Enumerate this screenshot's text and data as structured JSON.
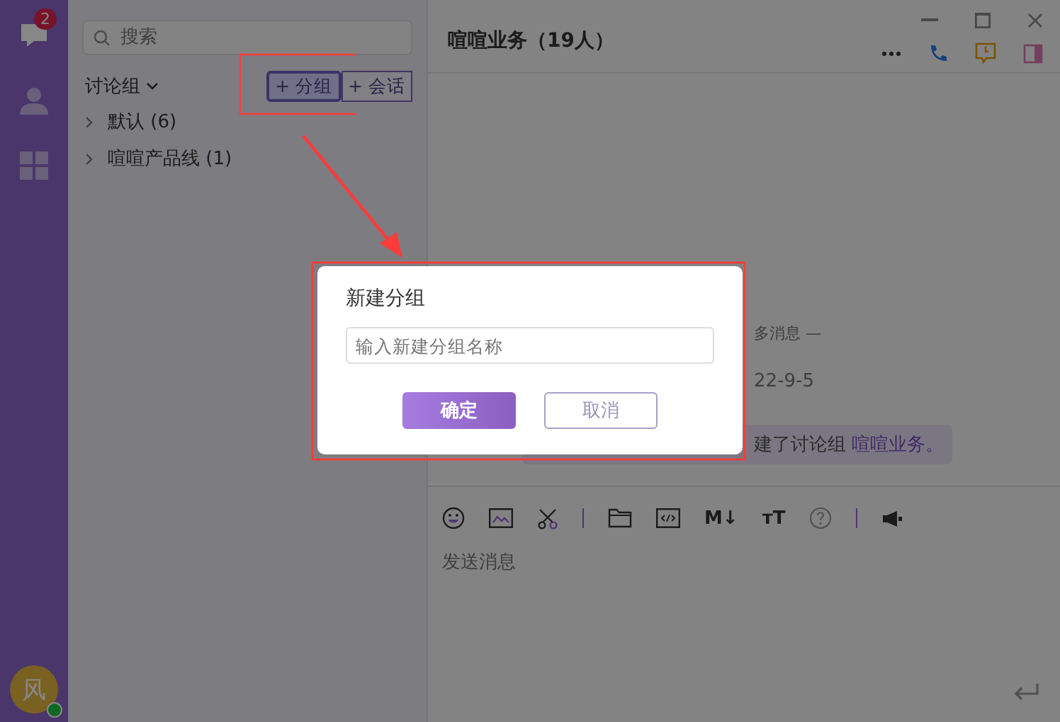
{
  "rail": {
    "items": [
      {
        "kind": "chat",
        "badge": "2",
        "selected": true
      },
      {
        "kind": "contacts",
        "selected": false
      },
      {
        "kind": "apps",
        "selected": false
      }
    ],
    "avatar": {
      "initial": "风",
      "online": true
    }
  },
  "search": {
    "placeholder": "搜索"
  },
  "list_header": {
    "title": "讨论组",
    "buttons": [
      {
        "label": "+ 分组",
        "selected": true
      },
      {
        "label": "+ 会话",
        "selected": false
      }
    ]
  },
  "groups": [
    {
      "label": "默认 (6)",
      "expanded": false
    },
    {
      "label": "喧喧产品线 (1)",
      "expanded": false
    }
  ],
  "chat": {
    "title": "喧喧业务（19人）",
    "messages": [
      {
        "kind": "divider",
        "text": "多消息 —"
      },
      {
        "kind": "date",
        "text": "22-9-5"
      },
      {
        "kind": "notice",
        "text": "建了讨论组 ",
        "link": "喧喧业务。"
      }
    ],
    "toolbar": [
      {
        "kind": "emoji"
      },
      {
        "kind": "image"
      },
      {
        "kind": "scissors"
      },
      {
        "kind": "sep"
      },
      {
        "kind": "folder"
      },
      {
        "kind": "code"
      },
      {
        "kind": "text",
        "text": "M↓"
      },
      {
        "kind": "text",
        "text": "ᴛT"
      },
      {
        "kind": "help"
      },
      {
        "kind": "sep"
      },
      {
        "kind": "megaphone"
      }
    ],
    "input": {
      "placeholder": "发送消息"
    }
  },
  "dialog": {
    "title": "新建分组",
    "field": {
      "placeholder": "输入新建分组名称"
    },
    "buttons": [
      {
        "label": "确定",
        "kind": "primary"
      },
      {
        "label": "取消",
        "kind": "secondary"
      }
    ]
  }
}
